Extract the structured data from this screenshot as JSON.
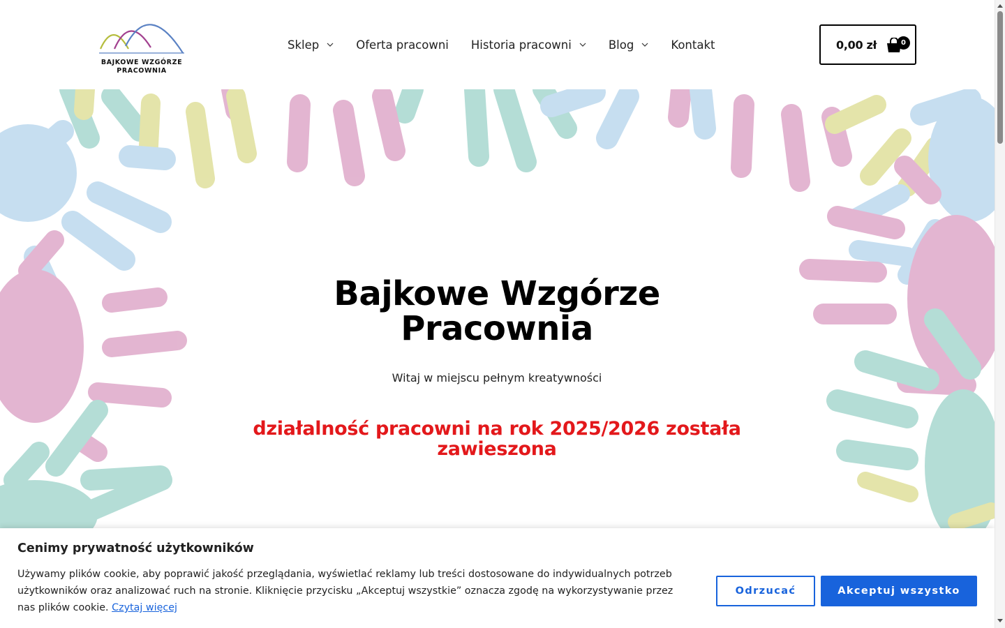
{
  "brand": {
    "logo_line1": "BAJKOWE WZGÓRZE",
    "logo_line2": "PRACOWNIA",
    "logo_colors": [
      "#b5bd3d",
      "#a2408f",
      "#5b82c4"
    ]
  },
  "nav": {
    "items": [
      {
        "label": "Sklep",
        "has_dropdown": true
      },
      {
        "label": "Oferta pracowni",
        "has_dropdown": false
      },
      {
        "label": "Historia pracowni",
        "has_dropdown": true
      },
      {
        "label": "Blog",
        "has_dropdown": true
      },
      {
        "label": "Kontakt",
        "has_dropdown": false
      }
    ]
  },
  "cart": {
    "total": "0,00 zł",
    "count": "0",
    "icon": "shopping-bag-icon"
  },
  "hero": {
    "title_line1": "Bajkowe Wzgórze",
    "title_line2": "Pracownia",
    "subtitle": "Witaj w miejscu pełnym kreatywności",
    "notice_line1": "działalność pracowni na rok 2025/2026 została",
    "notice_line2": "zawieszona",
    "notice_color": "#e3181b",
    "handprint_colors": {
      "blue": "#c3ddf0",
      "pink": "#e2b2cf",
      "teal": "#b0dcd4",
      "yellow": "#e3e3a6"
    }
  },
  "cookie": {
    "title": "Cenimy prywatność użytkowników",
    "text": "Używamy plików cookie, aby poprawić jakość przeglądania, wyświetlać reklamy lub treści dostosowane do indywidualnych potrzeb użytkowników oraz analizować ruch na stronie. Kliknięcie przycisku „Akceptuj wszystkie” oznacza zgodę na wykorzystywanie przez nas plików cookie. ",
    "link": "Czytaj więcej",
    "reject_label": "Odrzucać",
    "accept_label": "Akceptuj wszystko",
    "accent_color": "#1863dc"
  }
}
